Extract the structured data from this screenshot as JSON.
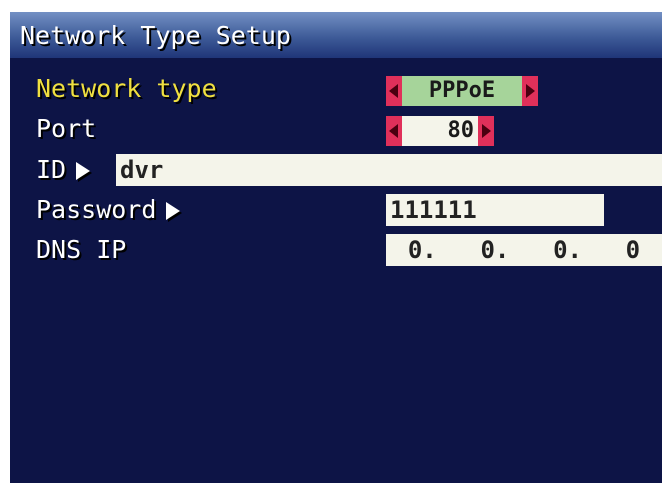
{
  "title": "Network Type Setup",
  "network_type": {
    "label": "Network type",
    "value": "PPPoE"
  },
  "port": {
    "label": "Port",
    "value": "80"
  },
  "id": {
    "label": "ID",
    "value": "dvr"
  },
  "password": {
    "label": "Password",
    "value": "111111"
  },
  "dns_ip": {
    "label": "DNS IP",
    "octets": [
      "0.",
      "0.",
      "0.",
      "0"
    ]
  }
}
